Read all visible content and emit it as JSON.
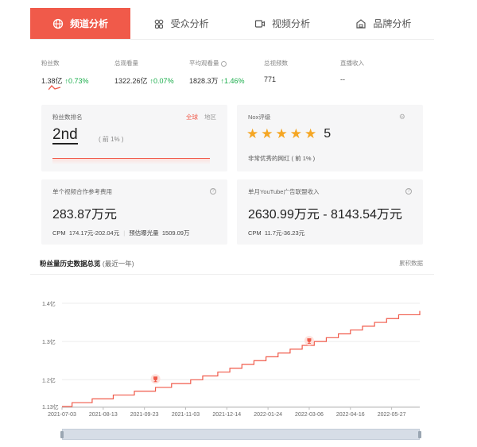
{
  "tabs": [
    {
      "label": "频道分析",
      "icon": "globe-icon",
      "active": true
    },
    {
      "label": "受众分析",
      "icon": "audience-icon",
      "active": false
    },
    {
      "label": "视频分析",
      "icon": "video-icon",
      "active": false
    },
    {
      "label": "品牌分析",
      "icon": "brand-icon",
      "active": false
    }
  ],
  "metrics": [
    {
      "label": "粉丝数",
      "value": "1.38亿",
      "change": "↑0.73%"
    },
    {
      "label": "总观看量",
      "value": "1322.26亿",
      "change": "↑0.07%"
    },
    {
      "label": "平均观看量",
      "value": "1828.3万",
      "change": "↑1.46%"
    },
    {
      "label": "总视频数",
      "value": "771",
      "change": ""
    },
    {
      "label": "直播收入",
      "value": "--",
      "change": ""
    }
  ],
  "rank_card": {
    "title": "粉丝数排名",
    "scope_global": "全球",
    "scope_region": "地区",
    "rank": "2nd",
    "percentile": "( 前 1% )"
  },
  "nox_card": {
    "title": "Nox评级",
    "score": "5",
    "stars": 5,
    "desc": "非常优秀的网红 ( 前 1% )"
  },
  "video_price_card": {
    "title": "单个视频合作参考费用",
    "value": "283.87万元",
    "cpm_label": "CPM",
    "cpm": "174.17元-202.04元",
    "exposure_label": "预估曝光量",
    "exposure": "1509.09万"
  },
  "ad_income_card": {
    "title": "单月YouTube广告联盟收入",
    "value": "2630.99万元 - 8143.54万元",
    "cpm_label": "CPM",
    "cpm": "11.7元-36.23元"
  },
  "history": {
    "title": "粉丝量历史数据总览",
    "subtitle": "(最近一年)",
    "right_link": "累积数据"
  },
  "colors": {
    "accent": "#f05a4a",
    "up": "#1aad4b",
    "star": "#f5a623"
  },
  "chart_data": {
    "type": "line",
    "title": "",
    "xlabel": "",
    "ylabel": "",
    "x_ticks": [
      "2021-07-03",
      "2021-08-13",
      "2021-09-23",
      "2021-11-03",
      "2021-12-14",
      "2022-01-24",
      "2022-03-06",
      "2022-04-16",
      "2022-05-27"
    ],
    "y_ticks": [
      "1.13亿",
      "1.2亿",
      "1.3亿",
      "1.4亿"
    ],
    "ylim": [
      1.13,
      1.4
    ],
    "grid": "horizontal",
    "series": [
      {
        "values": [
          [
            "2021-07-03",
            1.13
          ],
          [
            "2021-07-13",
            1.14
          ],
          [
            "2021-08-02",
            1.15
          ],
          [
            "2021-08-23",
            1.16
          ],
          [
            "2021-09-13",
            1.17
          ],
          [
            "2021-10-04",
            1.18
          ],
          [
            "2021-10-20",
            1.19
          ],
          [
            "2021-11-08",
            1.2
          ],
          [
            "2021-11-20",
            1.21
          ],
          [
            "2021-12-05",
            1.22
          ],
          [
            "2021-12-17",
            1.23
          ],
          [
            "2021-12-29",
            1.24
          ],
          [
            "2022-01-10",
            1.25
          ],
          [
            "2022-01-22",
            1.26
          ],
          [
            "2022-02-03",
            1.27
          ],
          [
            "2022-02-15",
            1.28
          ],
          [
            "2022-02-27",
            1.29
          ],
          [
            "2022-03-11",
            1.3
          ],
          [
            "2022-03-23",
            1.31
          ],
          [
            "2022-04-04",
            1.32
          ],
          [
            "2022-04-16",
            1.33
          ],
          [
            "2022-04-28",
            1.34
          ],
          [
            "2022-05-10",
            1.35
          ],
          [
            "2022-05-22",
            1.36
          ],
          [
            "2022-06-03",
            1.37
          ],
          [
            "2022-06-24",
            1.38
          ]
        ]
      }
    ],
    "markers": [
      {
        "x": "2021-10-04",
        "y": 1.2,
        "icon": "trophy-icon"
      },
      {
        "x": "2022-03-06",
        "y": 1.3,
        "icon": "trophy-icon"
      }
    ]
  }
}
